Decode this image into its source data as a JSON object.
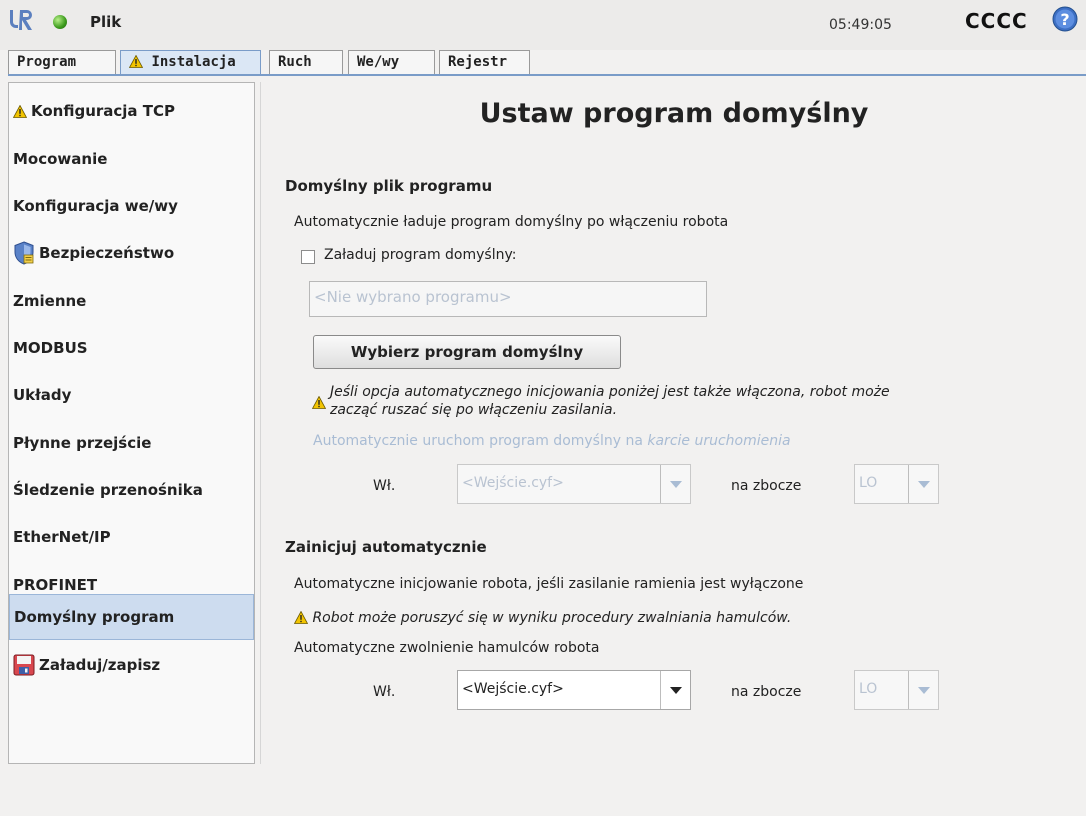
{
  "topbar": {
    "file_menu": "Plik",
    "clock": "05:49:05",
    "robot_name": "CCCC"
  },
  "tabs": [
    {
      "label": "Program"
    },
    {
      "label": "Instalacja",
      "warning": true,
      "active": true
    },
    {
      "label": "Ruch"
    },
    {
      "label": "We/wy"
    },
    {
      "label": "Rejestr"
    }
  ],
  "sidebar": {
    "items": [
      {
        "label": "Konfiguracja TCP",
        "icon": "warning-icon"
      },
      {
        "label": "Mocowanie"
      },
      {
        "label": "Konfiguracja we/wy"
      },
      {
        "label": "Bezpieczeństwo",
        "icon": "shield-icon"
      },
      {
        "label": "Zmienne"
      },
      {
        "label": "MODBUS"
      },
      {
        "label": "Układy"
      },
      {
        "label": "Płynne przejście"
      },
      {
        "label": "Śledzenie przenośnika"
      },
      {
        "label": "EtherNet/IP"
      },
      {
        "label": "PROFINET"
      },
      {
        "label": "Domyślny program",
        "selected": true
      },
      {
        "label": "Załaduj/zapisz",
        "icon": "floppy-icon"
      }
    ]
  },
  "main": {
    "title": "Ustaw program domyślny",
    "section1": {
      "title": "Domyślny plik programu",
      "description": "Automatycznie ładuje program domyślny po włączeniu robota",
      "checkbox_label": "Załaduj program domyślny:",
      "checkbox_checked": false,
      "program_placeholder": "<Nie wybrano programu>",
      "select_button": "Wybierz program domyślny",
      "warning_line1": "Jeśli opcja automatycznego inicjowania poniżej jest także włączona, robot może",
      "warning_line2": "zacząć ruszać się po włączeniu zasilania.",
      "autostart_text": "Automatycznie uruchom program domyślny na ",
      "autostart_text_italic": "karcie uruchomienia",
      "on_label": "Wł.",
      "input_select": "<Wejście.cyf>",
      "edge_label": "na zbocze",
      "edge_select": "LO"
    },
    "section2": {
      "title": "Zainicjuj automatycznie",
      "description": "Automatyczne inicjowanie robota, jeśli zasilanie ramienia jest wyłączone",
      "warning": "Robot może poruszyć się w wyniku procedury zwalniania hamulców.",
      "brake_text": "Automatyczne zwolnienie hamulców robota",
      "on_label": "Wł.",
      "input_select": "<Wejście.cyf>",
      "edge_label": "na zbocze",
      "edge_select": "LO"
    }
  },
  "colors": {
    "accent": "#7a9cc8",
    "selected": "#cddcef",
    "disabled_text": "#a9bcd4",
    "warning": "#f2c400"
  }
}
